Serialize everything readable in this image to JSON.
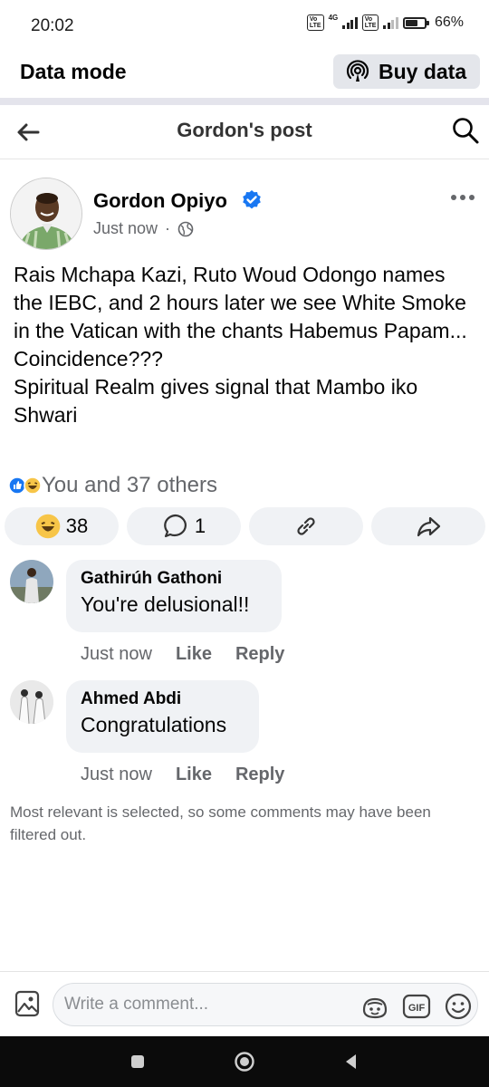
{
  "status": {
    "time": "20:02",
    "sim1_label": "Vo\nLTE",
    "sim1_network": "4G",
    "sim2_label": "Vo\nLTE",
    "battery_text": "66%",
    "battery_level": 0.66
  },
  "data_bar": {
    "title": "Data mode",
    "buy_label": "Buy data"
  },
  "header": {
    "title": "Gordon's post"
  },
  "post": {
    "author": "Gordon Opiyo",
    "time": "Just now",
    "separator": "·",
    "audience_icon": "globe-icon",
    "body": "Rais Mchapa Kazi, Ruto Woud Odongo names the IEBC, and 2 hours later we see White Smoke in the Vatican with the chants Habemus Papam...\nCoincidence???\nSpiritual Realm gives signal that Mambo iko Shwari",
    "reactions_summary": "You and 37 others",
    "reaction_icons": [
      "like-icon",
      "haha-icon"
    ],
    "actions": {
      "reaction_count": "38",
      "comment_count": "1"
    }
  },
  "comments": [
    {
      "name": "Gathirúh Gathoni",
      "text": "You're delusional!!",
      "time": "Just now",
      "like_label": "Like",
      "reply_label": "Reply"
    },
    {
      "name": "Ahmed Abdi",
      "text": "Congratulations",
      "time": "Just now",
      "like_label": "Like",
      "reply_label": "Reply"
    }
  ],
  "filter_note": "Most relevant is selected, so some comments may have been filtered out.",
  "composer": {
    "placeholder": "Write a comment...",
    "gif_label": "GIF"
  },
  "colors": {
    "accent": "#1877f2",
    "muted": "#65676b",
    "bubble": "#f0f2f5"
  }
}
